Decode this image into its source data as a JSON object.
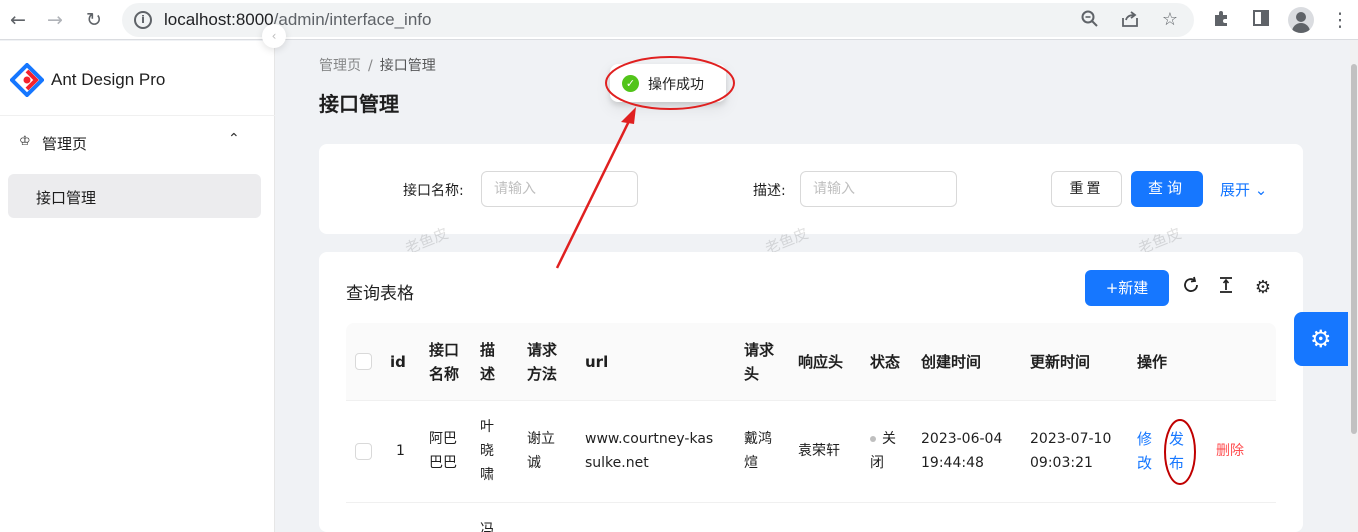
{
  "browser": {
    "url_host": "localhost:8000",
    "url_path": "/admin/interface_info"
  },
  "sidebar": {
    "brand": "Ant Design Pro",
    "group_label": "管理页",
    "item_label": "接口管理"
  },
  "breadcrumb": [
    "管理页",
    "接口管理"
  ],
  "page_title": "接口管理",
  "toast": {
    "message": "操作成功",
    "type": "success"
  },
  "search": {
    "name_label": "接口名称:",
    "name_placeholder": "请输入",
    "desc_label": "描述:",
    "desc_placeholder": "请输入",
    "reset_label": "重置",
    "query_label": "查询",
    "expand_label": "展开"
  },
  "watermark": "老鱼皮",
  "table": {
    "title": "查询表格",
    "new_label": "+新建",
    "columns": [
      "id",
      "接口名称",
      "描述",
      "请求方法",
      "url",
      "请求头",
      "响应头",
      "状态",
      "创建时间",
      "更新时间",
      "操作"
    ],
    "rows": [
      {
        "id": "1",
        "name": "阿巴巴巴",
        "desc": "叶晓啸",
        "method": "谢立诚",
        "url": "www.courtney-kassulke.net",
        "req_header": "戴鸿煊",
        "resp_header": "袁荣轩",
        "status": "关闭",
        "created": "2023-06-04 19:44:48",
        "updated": "2023-07-10 09:03:21",
        "actions": [
          "修改",
          "发布",
          "删除"
        ]
      }
    ],
    "partial_next_row": "冯"
  },
  "colors": {
    "primary": "#1677ff",
    "success": "#52c41a",
    "danger": "#ff4d4f",
    "annotation": "#e02020"
  }
}
